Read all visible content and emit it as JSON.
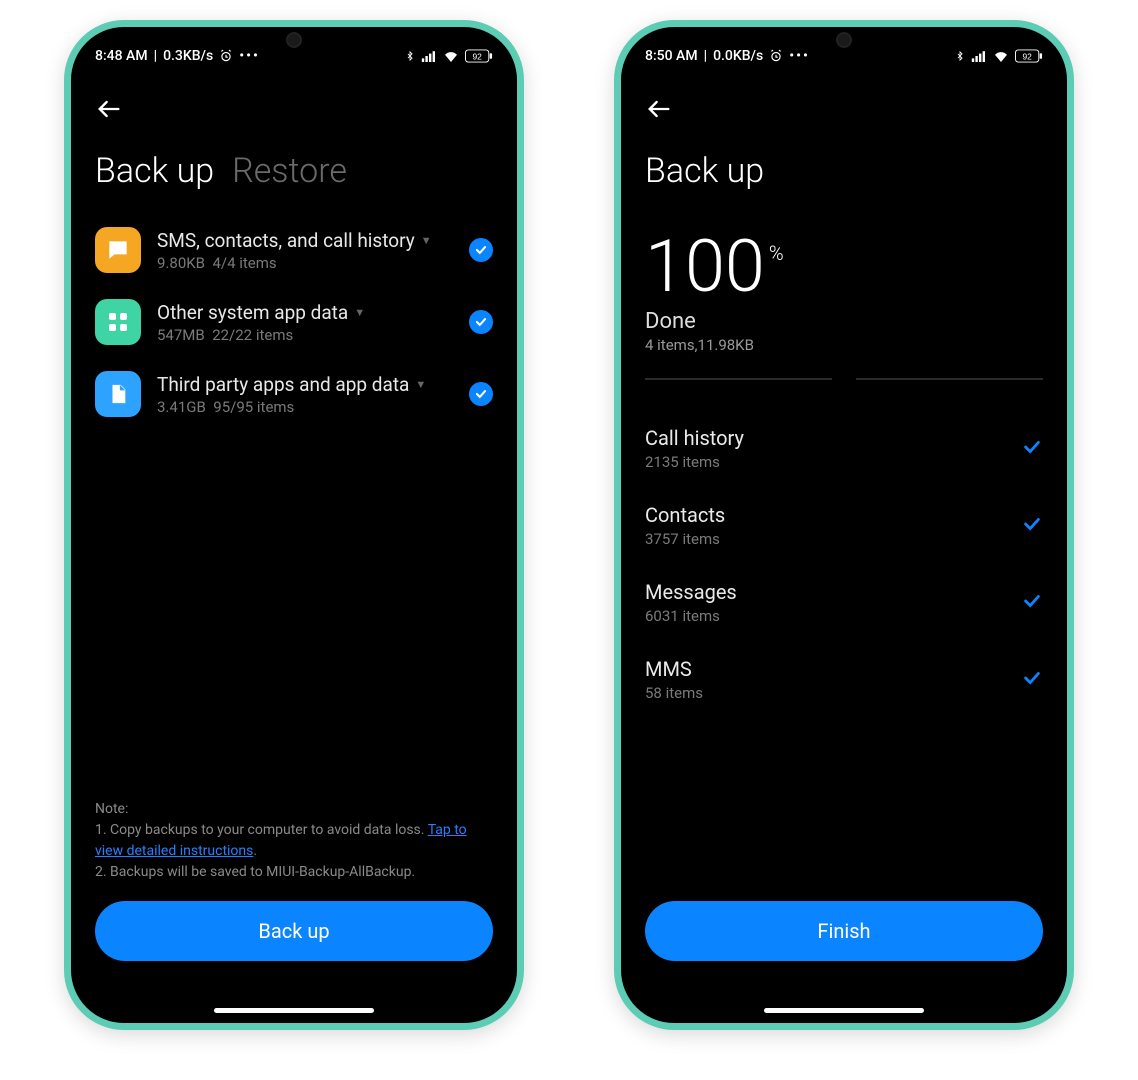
{
  "phone1": {
    "status": {
      "time": "8:48 AM",
      "net_speed": "0.3KB/s",
      "battery": "92"
    },
    "tabs": {
      "active": "Back up",
      "inactive": "Restore"
    },
    "categories": [
      {
        "title": "SMS, contacts, and call history",
        "size": "9.80KB",
        "items": "4/4 items",
        "icon_bg": "#f5a623",
        "icon": "message"
      },
      {
        "title": "Other system app data",
        "size": "547MB",
        "items": "22/22 items",
        "icon_bg": "#3fd4a4",
        "icon": "grid"
      },
      {
        "title": "Third party apps and app data",
        "size": "3.41GB",
        "items": "95/95 items",
        "icon_bg": "#2da2ff",
        "icon": "file"
      }
    ],
    "note": {
      "heading": "Note:",
      "line1_a": "1. Copy backups to your computer to avoid data loss. ",
      "link": "Tap to view detailed instructions",
      "line1_b": ".",
      "line2": "2. Backups will be saved to MIUI-Backup-AllBackup."
    },
    "button": "Back up"
  },
  "phone2": {
    "status": {
      "time": "8:50 AM",
      "net_speed": "0.0KB/s",
      "battery": "92"
    },
    "title": "Back up",
    "percent": "100",
    "percent_sym": "%",
    "done": "Done",
    "summary": "4 items,11.98KB",
    "results": [
      {
        "title": "Call history",
        "sub": "2135 items"
      },
      {
        "title": "Contacts",
        "sub": "3757 items"
      },
      {
        "title": "Messages",
        "sub": "6031 items"
      },
      {
        "title": "MMS",
        "sub": "58 items"
      }
    ],
    "button": "Finish"
  }
}
